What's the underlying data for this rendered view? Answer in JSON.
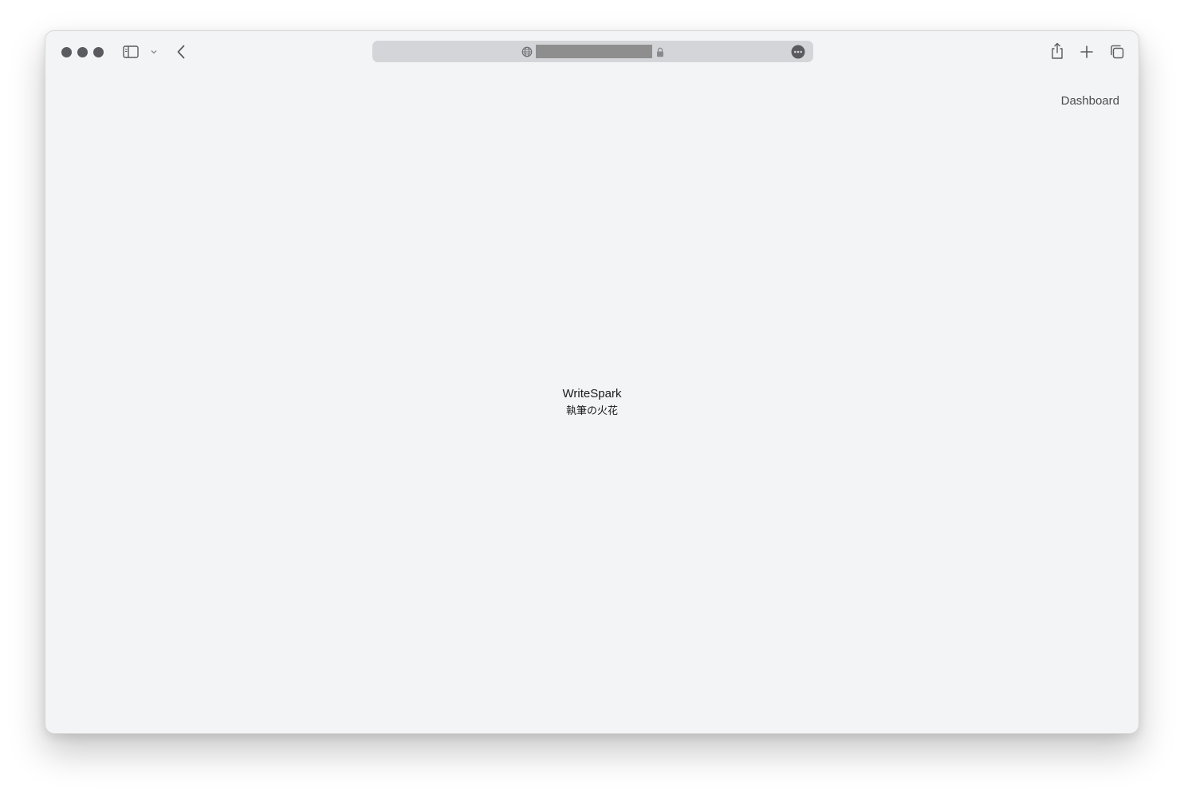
{
  "browser": {
    "url": "",
    "icons": {
      "sidebar": "sidebar-icon",
      "chevron": "chevron-down-icon",
      "back": "back-arrow-icon",
      "globe": "globe-icon",
      "lock": "lock-icon",
      "more": "ellipsis-circle-icon",
      "share": "share-icon",
      "new_tab": "plus-icon",
      "tabs": "tabs-overview-icon"
    }
  },
  "nav": {
    "dashboard_label": "Dashboard"
  },
  "brand": {
    "name": "WriteSpark",
    "subtitle": "執筆の火花"
  },
  "colors": {
    "page_background": "#f3f4f6",
    "address_bar": "#d4d5d8",
    "text": "#1a1a1a",
    "nav_text": "#4b4b50"
  }
}
